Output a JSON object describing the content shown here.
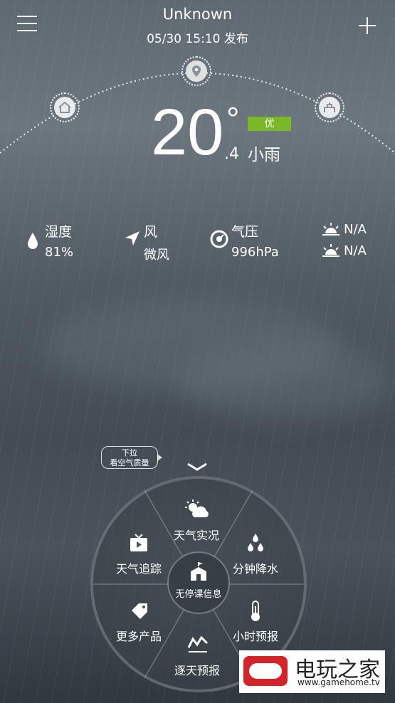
{
  "header": {
    "city": "Unknown",
    "publish_time": "05/30  15:10 发布"
  },
  "current": {
    "temperature": "20",
    "degree_symbol": "°",
    "decimal": ".4",
    "aqi_label": "优",
    "condition": "小雨"
  },
  "stats": {
    "humidity_label": "湿度",
    "humidity_value": "81%",
    "wind_label": "风",
    "wind_value": "微风",
    "pressure_label": "气压",
    "pressure_value": "996hPa",
    "sunrise_value": "N/A",
    "sunset_value": "N/A"
  },
  "hint": {
    "line1": "下拉",
    "line2": "看空气质量"
  },
  "wheel": {
    "top": "天气实况",
    "top_right": "分钟降水",
    "bottom_right": "小时预报",
    "bottom": "逐天预报",
    "bottom_left": "更多产品",
    "top_left": "天气追踪",
    "center": "无停课信息"
  },
  "watermark": {
    "name": "电玩之家",
    "url": "www.gamehome.tv"
  },
  "colors": {
    "aqi_good": "#7cb728",
    "watermark_red": "#d6232a"
  }
}
